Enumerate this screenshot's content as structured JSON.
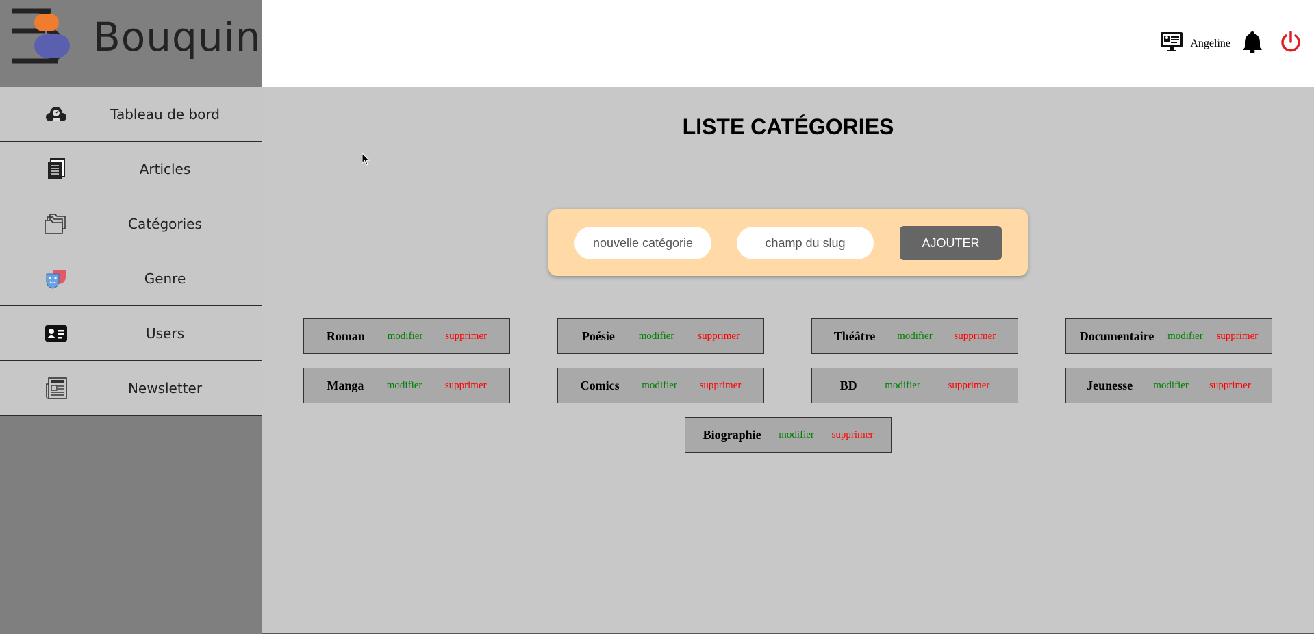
{
  "app": {
    "logo_text": "Bouquine"
  },
  "sidebar": {
    "items": [
      {
        "label": "Tableau de bord",
        "icon": "dashboard-icon"
      },
      {
        "label": "Articles",
        "icon": "documents-icon"
      },
      {
        "label": "Catégories",
        "icon": "folders-icon"
      },
      {
        "label": "Genre",
        "icon": "theater-masks-icon"
      },
      {
        "label": "Users",
        "icon": "id-card-icon"
      },
      {
        "label": "Newsletter",
        "icon": "newspaper-icon"
      }
    ]
  },
  "header": {
    "user_name": "Angeline"
  },
  "main": {
    "title": "LISTE CATÉGORIES",
    "form": {
      "name_placeholder": "nouvelle catégorie",
      "slug_placeholder": "champ du slug",
      "submit_label": "AJOUTER"
    },
    "edit_label": "modifier",
    "delete_label": "supprimer",
    "categories": [
      {
        "name": "Roman"
      },
      {
        "name": "Poésie"
      },
      {
        "name": "Théâtre"
      },
      {
        "name": "Documentaire"
      },
      {
        "name": "Manga"
      },
      {
        "name": "Comics"
      },
      {
        "name": "BD"
      },
      {
        "name": "Jeunesse"
      },
      {
        "name": "Biographie"
      }
    ]
  },
  "colors": {
    "sidebar_bg": "#7f7f7f",
    "nav_item_bg": "#c7c7c7",
    "main_bg": "#c8c8c8",
    "form_bg": "#ffd9a6",
    "button_bg": "#666666",
    "edit_color": "#008000",
    "delete_color": "#ff0000",
    "logo_orange": "#f07c2e",
    "logo_blue": "#5a5fb0",
    "power_red": "#e02020"
  }
}
